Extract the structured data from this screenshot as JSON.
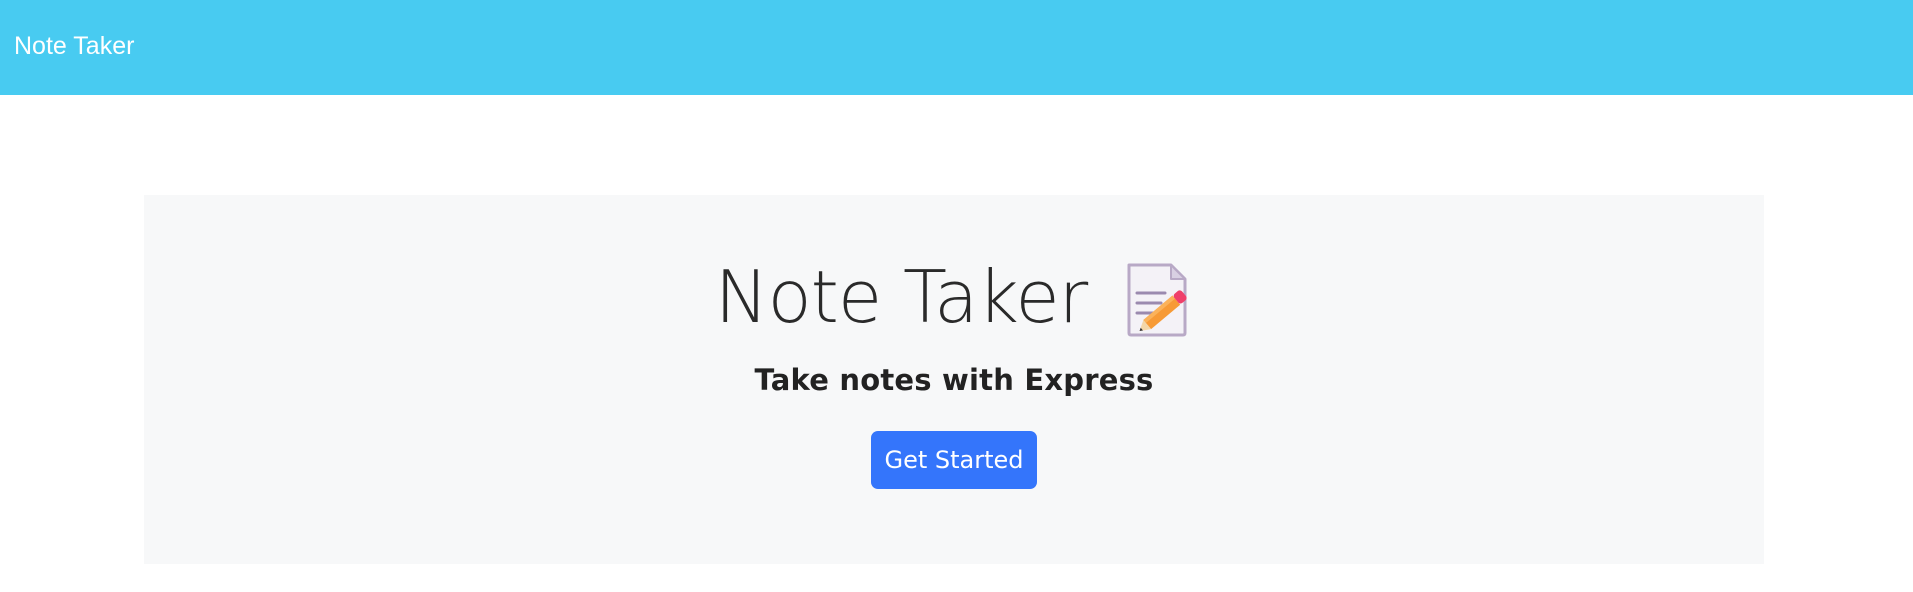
{
  "navbar": {
    "brand_label": "Note Taker",
    "background_color": "#48cbf1"
  },
  "jumbotron": {
    "title": "Note Taker",
    "title_icon": "memo-icon",
    "subtitle": "Take notes with Express",
    "cta_label": "Get Started",
    "cta_color": "#3475fb",
    "background_color": "#f7f8f9"
  }
}
